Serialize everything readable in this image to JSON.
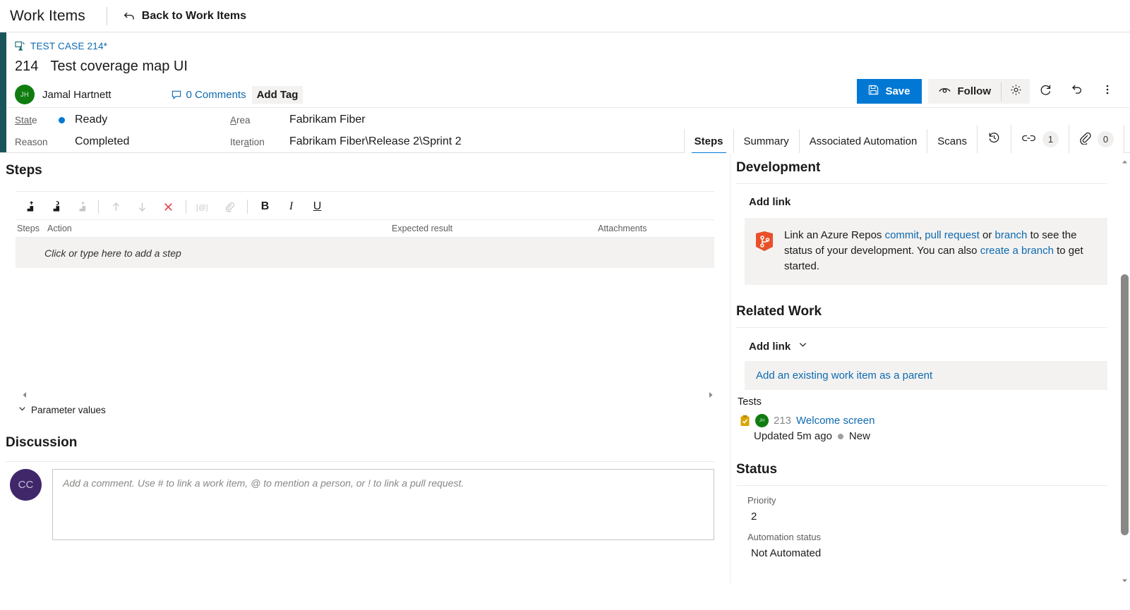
{
  "topbar": {
    "title": "Work Items",
    "back_label": "Back to Work Items",
    "back_icon": "back-arrow-icon"
  },
  "workitem": {
    "breadcrumb": "TEST CASE 214*",
    "type_icon": "test-case-icon",
    "id": "214",
    "title": "Test coverage map UI",
    "assigned_to": "Jamal Hartnett",
    "assigned_initials": "JH",
    "comments_label": "0 Comments",
    "add_tag_label": "Add Tag"
  },
  "actions": {
    "save_label": "Save",
    "save_icon": "save-disk-icon",
    "follow_label": "Follow",
    "follow_icon": "eye-icon",
    "settings_icon": "gear-icon",
    "refresh_icon": "refresh-icon",
    "undo_icon": "undo-icon",
    "more_icon": "more-vertical-icon"
  },
  "fields": {
    "state_label": "State",
    "state_value": "Ready",
    "state_color": "#0078d4",
    "reason_label": "Reason",
    "reason_value": "Completed",
    "area_label": "Area",
    "area_value": "Fabrikam Fiber",
    "iteration_label": "Iteration",
    "iteration_value": "Fabrikam Fiber\\Release 2\\Sprint 2"
  },
  "tabs": [
    {
      "label": "Steps",
      "active": true
    },
    {
      "label": "Summary",
      "active": false
    },
    {
      "label": "Associated Automation",
      "active": false
    },
    {
      "label": "Scans",
      "active": false
    }
  ],
  "tab_icons": [
    {
      "icon": "history-icon",
      "badge": null
    },
    {
      "icon": "link-icon",
      "badge": "1"
    },
    {
      "icon": "paperclip-icon",
      "badge": "0"
    }
  ],
  "steps": {
    "heading": "Steps",
    "toolbar": [
      {
        "icon": "insert-step-icon",
        "enabled": true
      },
      {
        "icon": "insert-shared-step-icon",
        "enabled": true
      },
      {
        "icon": "create-shared-step-icon",
        "enabled": false
      },
      {
        "icon": "move-up-icon",
        "enabled": false
      },
      {
        "icon": "move-down-icon",
        "enabled": false
      },
      {
        "icon": "delete-icon",
        "enabled": true
      },
      {
        "icon": "insert-parameter-icon",
        "enabled": false
      },
      {
        "icon": "attach-icon",
        "enabled": false
      },
      {
        "icon": "bold-icon",
        "enabled": true,
        "text": "B"
      },
      {
        "icon": "italic-icon",
        "enabled": true,
        "text": "I"
      },
      {
        "icon": "underline-icon",
        "enabled": true,
        "text": "U"
      }
    ],
    "columns": [
      "Steps",
      "Action",
      "Expected result",
      "Attachments"
    ],
    "placeholder_row": "Click or type here to add a step",
    "parameter_values_label": "Parameter values"
  },
  "discussion": {
    "heading": "Discussion",
    "avatar_initials": "CC",
    "comment_placeholder": "Add a comment. Use # to link a work item, @ to mention a person, or ! to link a pull request."
  },
  "development": {
    "heading": "Development",
    "add_link_label": "Add link",
    "icon": "azure-repos-icon",
    "text_part1": "Link an Azure Repos ",
    "link_commit": "commit",
    "text_comma": ", ",
    "link_pull_request": "pull request",
    "text_or": " or ",
    "link_branch": "branch",
    "text_part2": " to see the status of your development. You can also ",
    "link_create_branch": "create a branch",
    "text_part3": " to get started."
  },
  "related_work": {
    "heading": "Related Work",
    "add_link_label": "Add link",
    "chevron_icon": "chevron-down-icon",
    "parent_link": "Add an existing work item as a parent",
    "group_label": "Tests",
    "item": {
      "clip_icon": "test-case-clipboard-icon",
      "avatar_initials": "JH",
      "id": "213",
      "name": "Welcome screen",
      "updated": "Updated 5m ago",
      "state": "New",
      "state_color": "#a19f9d"
    }
  },
  "status": {
    "heading": "Status",
    "priority_label": "Priority",
    "priority_value": "2",
    "automation_label": "Automation status",
    "automation_value": "Not Automated"
  },
  "colors": {
    "accent_bar": "#19545a",
    "primary": "#0078d4",
    "link": "#0e6ab0",
    "avatar_green": "#107c10",
    "avatar_purple": "#40276a"
  }
}
